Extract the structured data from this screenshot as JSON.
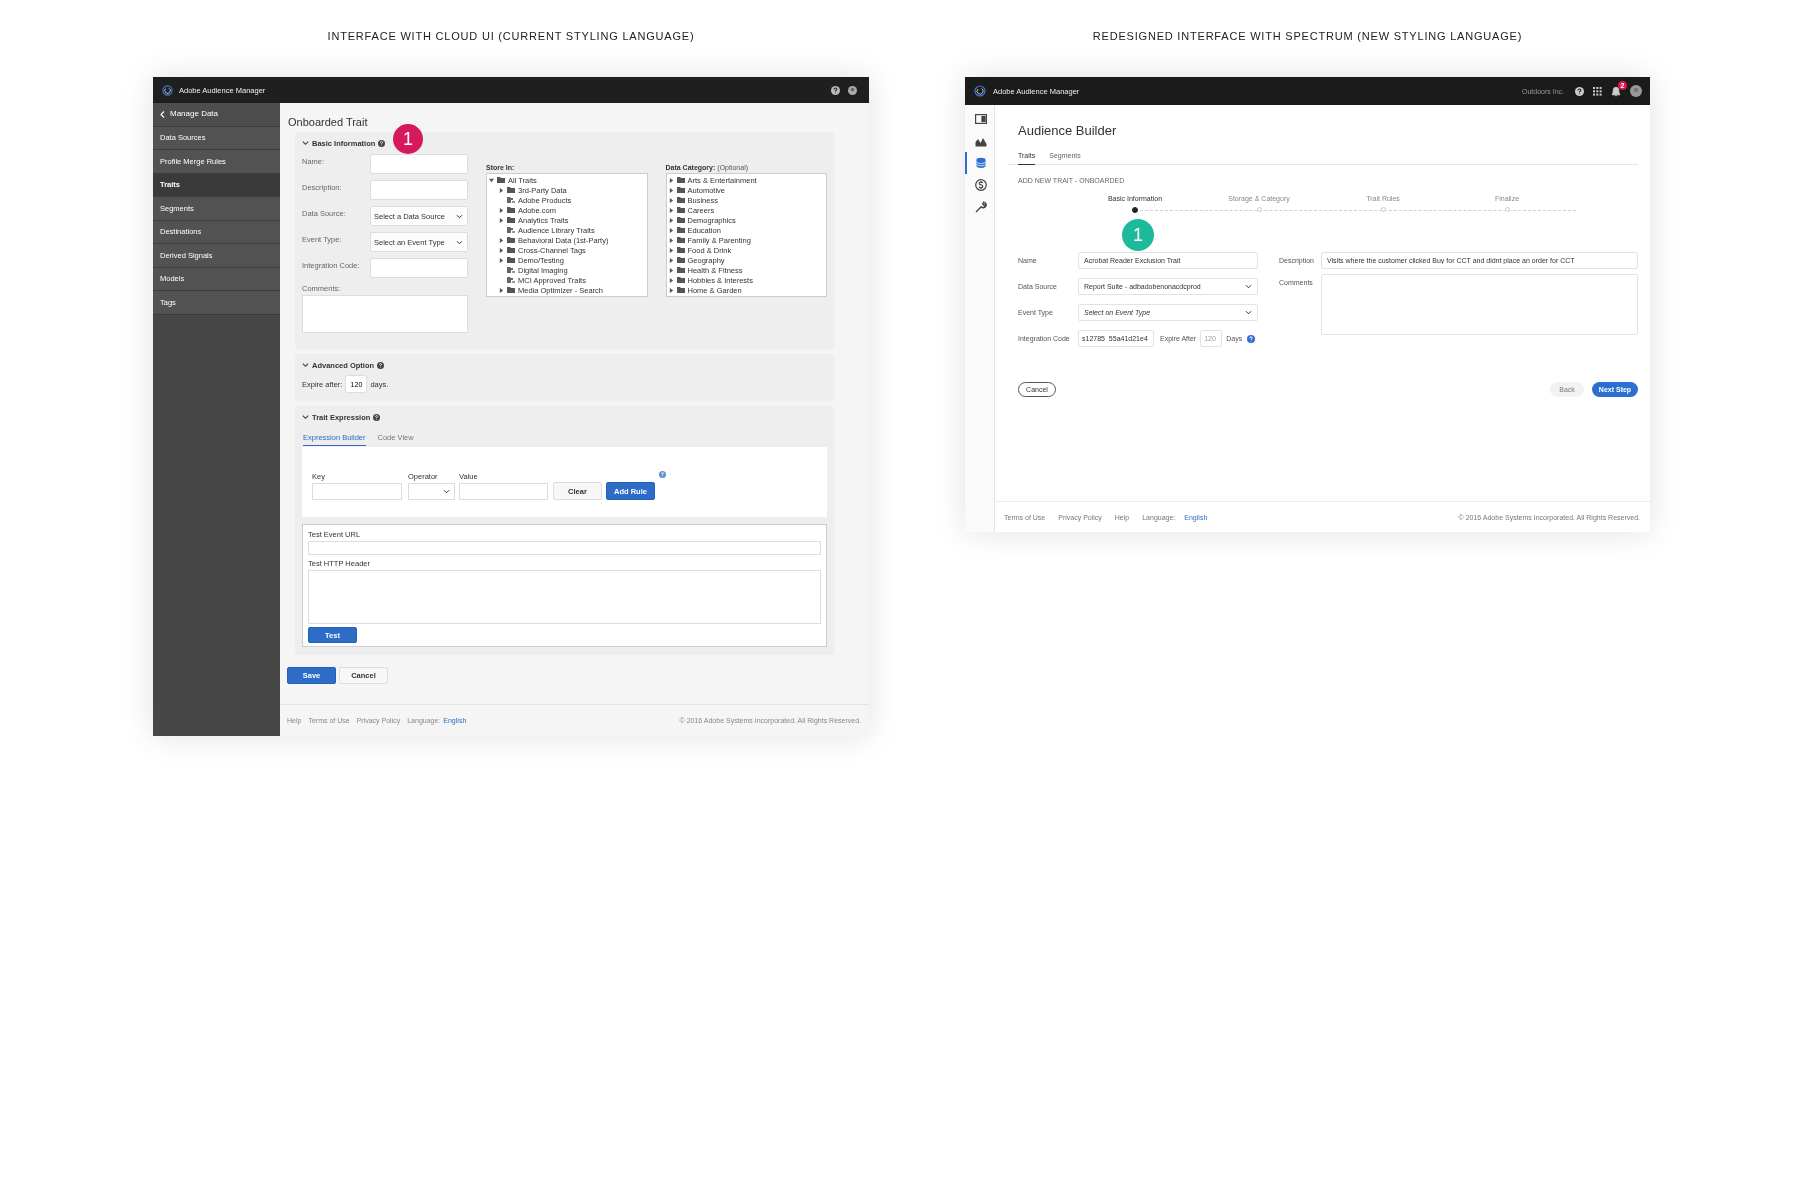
{
  "cloud_ui": {
    "caption": "INTERFACE WITH CLOUD UI (CURRENT STYLING LANGUAGE)",
    "app_title": "Adobe Audience Manager",
    "back_link": "Manage Data",
    "nav": [
      {
        "label": "Data Sources",
        "selected": false
      },
      {
        "label": "Profile Merge Rules",
        "selected": false
      },
      {
        "label": "Traits",
        "selected": true
      },
      {
        "label": "Segments",
        "selected": false
      },
      {
        "label": "Destinations",
        "selected": false
      },
      {
        "label": "Derived Signals",
        "selected": false
      },
      {
        "label": "Models",
        "selected": false
      },
      {
        "label": "Tags",
        "selected": false
      }
    ],
    "page_title": "Onboarded Trait",
    "badge": {
      "text": "1",
      "color": "#d6185c"
    },
    "basic_section": {
      "title": "Basic Information",
      "expanded": true,
      "fields": [
        {
          "label": "Name:",
          "kind": "text"
        },
        {
          "label": "Description:",
          "kind": "text"
        },
        {
          "label": "Data Source:",
          "kind": "select",
          "placeholder": "Select a Data Source"
        },
        {
          "label": "Event Type:",
          "kind": "select",
          "placeholder": "Select an Event Type"
        },
        {
          "label": "Integration Code:",
          "kind": "text"
        }
      ],
      "comments_label": "Comments:"
    },
    "store_in": {
      "label": "Store In:",
      "tree": [
        {
          "label": "All Traits",
          "kind": "folder",
          "expanded": true,
          "children": [
            {
              "label": "3rd-Party Data",
              "kind": "folder",
              "expanded": false
            },
            {
              "label": "Adobe Products",
              "kind": "trait"
            },
            {
              "label": "Adobe.com",
              "kind": "folder",
              "expanded": false
            },
            {
              "label": "Analytics Traits",
              "kind": "folder",
              "expanded": false
            },
            {
              "label": "Audience Library Traits",
              "kind": "trait"
            },
            {
              "label": "Behavioral Data (1st-Party)",
              "kind": "folder",
              "expanded": false
            },
            {
              "label": "Cross-Channel Tags",
              "kind": "folder",
              "expanded": false
            },
            {
              "label": "Demo/Testing",
              "kind": "folder",
              "expanded": false
            },
            {
              "label": "Digital Imaging",
              "kind": "trait"
            },
            {
              "label": "MCI Approved Traits",
              "kind": "trait"
            },
            {
              "label": "Media Optimizer - Search",
              "kind": "folder",
              "expanded": false
            }
          ]
        }
      ]
    },
    "data_category": {
      "label": "Data Category:",
      "hint": "(Optional)",
      "tree": [
        {
          "label": "Arts & Entertainment",
          "kind": "folder",
          "expanded": false
        },
        {
          "label": "Automotive",
          "kind": "folder",
          "expanded": false
        },
        {
          "label": "Business",
          "kind": "folder",
          "expanded": false
        },
        {
          "label": "Careers",
          "kind": "folder",
          "expanded": false
        },
        {
          "label": "Demographics",
          "kind": "folder",
          "expanded": false
        },
        {
          "label": "Education",
          "kind": "folder",
          "expanded": false
        },
        {
          "label": "Family & Parenting",
          "kind": "folder",
          "expanded": false
        },
        {
          "label": "Food & Drink",
          "kind": "folder",
          "expanded": false
        },
        {
          "label": "Geography",
          "kind": "folder",
          "expanded": false
        },
        {
          "label": "Health & Fitness",
          "kind": "folder",
          "expanded": false
        },
        {
          "label": "Hobbies & Interests",
          "kind": "folder",
          "expanded": false
        },
        {
          "label": "Home & Garden",
          "kind": "folder",
          "expanded": false
        }
      ]
    },
    "advanced_section": {
      "title": "Advanced Option",
      "expanded": true,
      "expire_label": "Expire after:",
      "expire_value": "120",
      "unit": "days."
    },
    "expression_section": {
      "title": "Trait Expression",
      "expanded": true,
      "tabs": [
        {
          "label": "Expression Builder",
          "selected": true
        },
        {
          "label": "Code View",
          "selected": false
        }
      ],
      "key_label": "Key",
      "operator_label": "Operator",
      "value_label": "Value",
      "buttons": [
        {
          "label": "Clear",
          "kind": "secondary"
        },
        {
          "label": "Add Rule",
          "kind": "primary"
        }
      ],
      "test_url_label": "Test Event URL",
      "test_header_label": "Test HTTP Header",
      "test_button": "Test"
    },
    "actions": [
      {
        "label": "Save",
        "kind": "primary"
      },
      {
        "label": "Cancel",
        "kind": "secondary"
      }
    ],
    "footer_links": [
      "Help",
      "Terms of Use",
      "Privacy Policy"
    ],
    "language_label": "Language:",
    "language": "English",
    "copyright": "© 2016 Adobe Systems Incorporated. All Rights Reserved."
  },
  "spectrum": {
    "caption": "REDESIGNED INTERFACE WITH SPECTRUM (NEW STYLING LANGUAGE)",
    "app_title": "Adobe Audience Manager",
    "org": "Outdoors Inc.",
    "notification_count": "2",
    "rail": [
      {
        "selected": false
      },
      {
        "selected": false
      },
      {
        "selected": true
      },
      {
        "selected": false
      },
      {
        "selected": false
      }
    ],
    "page_title": "Audience Builder",
    "tabs": [
      {
        "label": "Traits",
        "selected": true
      },
      {
        "label": "Segments",
        "selected": false
      }
    ],
    "section_label": "ADD NEW TRAIT - ONBOARDED",
    "steps": [
      {
        "label": "Basic Information",
        "selected": true
      },
      {
        "label": "Storage & Category",
        "selected": false
      },
      {
        "label": "Trait Rules",
        "selected": false
      },
      {
        "label": "Finalize",
        "selected": false
      }
    ],
    "badge": {
      "text": "1",
      "color": "#1cb99b"
    },
    "name": {
      "label": "Name",
      "value": "Acrobat Reader Exclusion Trait"
    },
    "data_source": {
      "label": "Data Source",
      "value": "Report Suite - adbadobenonacdcprod"
    },
    "event_type": {
      "label": "Event Type",
      "placeholder": "Select on Event Type"
    },
    "integration_code": {
      "label": "Integration Code",
      "value": "s12785_55a41d21e4"
    },
    "expire_after": {
      "label": "Expire After",
      "placeholder": "120",
      "unit": "Days"
    },
    "description": {
      "label": "Description",
      "value": "Visits where the customer clicked Buy for CCT and didnt place an order for CCT"
    },
    "comments": {
      "label": "Comments"
    },
    "cancel": "Cancel",
    "back": {
      "label": "Back",
      "disabled": true
    },
    "next": "Next Step",
    "footer_links": [
      "Terms of Use",
      "Privacy Policy",
      "Help"
    ],
    "language_label": "Language:",
    "language": "English",
    "copyright": "© 2016 Adobe Systems Incorporated. All Rights Reserved."
  }
}
